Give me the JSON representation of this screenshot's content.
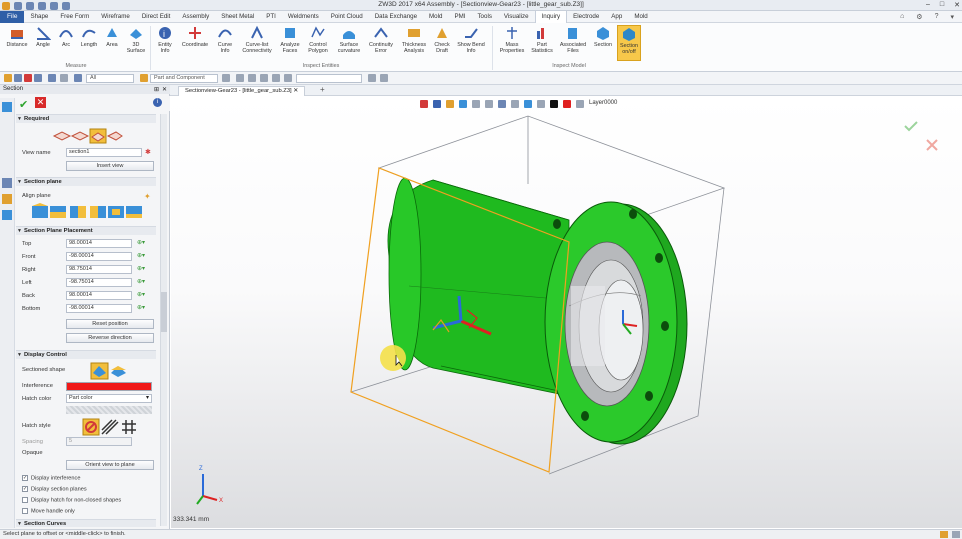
{
  "window": {
    "title": "ZW3D 2017  x64      Assembly - [Sectionview-Gear23 - [little_gear_sub.Z3]]"
  },
  "menu": {
    "file": "File",
    "items": [
      "Shape",
      "Free Form",
      "Wireframe",
      "Direct Edit",
      "Assembly",
      "Sheet Metal",
      "PTI",
      "Weldments",
      "Point Cloud",
      "Data Exchange",
      "Mold",
      "PMI",
      "Tools",
      "Visualize",
      "Inquiry",
      "Electrode",
      "App",
      "Mold"
    ],
    "active_index": 14
  },
  "ribbon": {
    "buttons": [
      "Distance",
      "Angle",
      "Arc",
      "Length",
      "Area",
      "3D\nSurface",
      "Entity\nInfo",
      "Coordinate",
      "Curve\nInfo",
      "Curve-list\nConnectivity",
      "Analyze\nFaces",
      "Control\nPolygon",
      "Surface\ncurvature",
      "Continuity\nError",
      "Thickness\nAnalysis",
      "Check\nDraft",
      "Show Bend\nInfo",
      "Mass\nProperties",
      "Part\nStatistics",
      "Associated\nFiles",
      "Section",
      "Section\non/off"
    ],
    "groups": [
      "Measure",
      "Inspect Entities",
      "Inspect Model"
    ]
  },
  "toolbar2": {
    "filter": "All",
    "pick": "Part and Component"
  },
  "panel": {
    "header": "Section",
    "required_title": "Required",
    "view_name_label": "View name",
    "view_name_value": "section1",
    "insert_view": "Insert view",
    "section_plane_title": "Section plane",
    "align_plane_label": "Align plane",
    "placement_title": "Section Plane Placement",
    "placements": [
      {
        "label": "Top",
        "value": "98.00014"
      },
      {
        "label": "Front",
        "value": "-98.00014"
      },
      {
        "label": "Right",
        "value": "98.75014"
      },
      {
        "label": "Left",
        "value": "-98.75014"
      },
      {
        "label": "Back",
        "value": "98.00014"
      },
      {
        "label": "Bottom",
        "value": "-98.00014"
      }
    ],
    "reset_position": "Reset position",
    "reverse_direction": "Reverse direction",
    "display_control_title": "Display Control",
    "sectioned_shape_label": "Sectioned shape",
    "interference_label": "Interference",
    "interference_color": "#f01818",
    "hatch_color_label": "Hatch color",
    "hatch_color_value": "Part color",
    "hatch_style_label": "Hatch style",
    "spacing_label": "Spacing",
    "spacing_value": "5",
    "opaque_label": "Opaque",
    "orient_view": "Orient view to plane",
    "checks": [
      {
        "label": "Display interference",
        "checked": true
      },
      {
        "label": "Display section planes",
        "checked": true
      },
      {
        "label": "Display hatch for non-closed shapes",
        "checked": false
      },
      {
        "label": "Move handle only",
        "checked": false
      }
    ],
    "section_curves_title": "Section Curves"
  },
  "tab": {
    "label": "Sectionview-Gear23 - [little_gear_sub.Z3]"
  },
  "viewport": {
    "layer": "Layer0000",
    "scale": "333.341 mm",
    "part_color": "#22c322"
  },
  "status": {
    "text": "Select plane to offset or <middle-click> to finish."
  }
}
